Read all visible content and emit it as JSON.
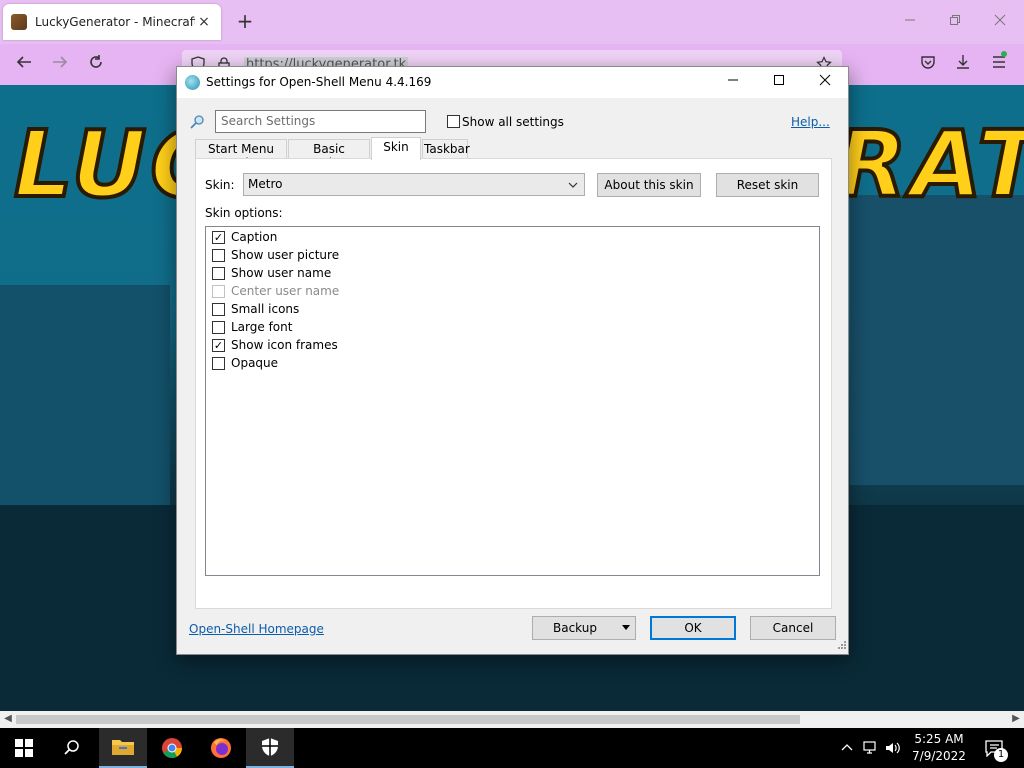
{
  "browser": {
    "tab_title": "LuckyGenerator - Minecraft Lic",
    "url": "https://luckygenerator.tk",
    "new_tab": "+",
    "tab_close": "×"
  },
  "page": {
    "logo_left": "LUC",
    "logo_right": "RAT"
  },
  "dialog": {
    "title": "Settings for Open-Shell Menu 4.4.169",
    "search_placeholder": "Search Settings",
    "show_all_label": "Show all settings",
    "show_all_checked": false,
    "help_link": "Help...",
    "tabs": [
      {
        "label": "Start Menu Style",
        "active": false
      },
      {
        "label": "Basic Settings",
        "active": false
      },
      {
        "label": "Skin",
        "active": true
      },
      {
        "label": "Taskbar",
        "active": false
      }
    ],
    "skin_label": "Skin:",
    "skin_value": "Metro",
    "about_skin_button": "About this skin",
    "reset_skin_button": "Reset skin",
    "skin_options_label": "Skin options:",
    "options": [
      {
        "label": "Caption",
        "checked": true,
        "enabled": true
      },
      {
        "label": "Show user picture",
        "checked": false,
        "enabled": true
      },
      {
        "label": "Show user name",
        "checked": false,
        "enabled": true
      },
      {
        "label": "Center user name",
        "checked": false,
        "enabled": false
      },
      {
        "label": "Small icons",
        "checked": false,
        "enabled": true
      },
      {
        "label": "Large font",
        "checked": false,
        "enabled": true
      },
      {
        "label": "Show icon frames",
        "checked": true,
        "enabled": true
      },
      {
        "label": "Opaque",
        "checked": false,
        "enabled": true
      }
    ],
    "homepage_link": "Open-Shell Homepage",
    "backup_button": "Backup",
    "ok_button": "OK",
    "cancel_button": "Cancel"
  },
  "taskbar": {
    "time": "5:25 AM",
    "date": "7/9/2022",
    "notification_count": "1"
  }
}
